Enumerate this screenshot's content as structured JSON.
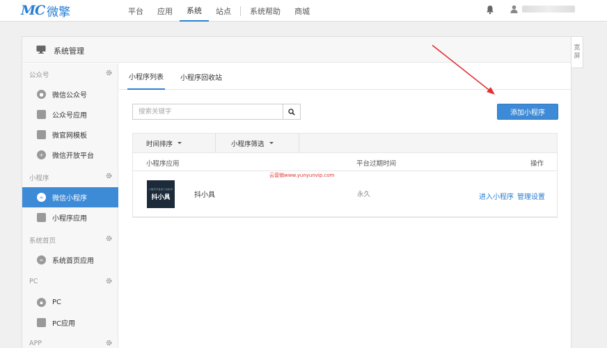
{
  "brand": {
    "mark": "MC",
    "name": "微擎"
  },
  "topnav": {
    "items": [
      {
        "label": "平台"
      },
      {
        "label": "应用"
      },
      {
        "label": "系统"
      },
      {
        "label": "站点"
      },
      {
        "label": "系统帮助"
      },
      {
        "label": "商城"
      }
    ],
    "active_index": 2,
    "notification_icon": "bell-icon",
    "user_icon": "user-icon"
  },
  "panel": {
    "title": "系统管理",
    "icon": "monitor-icon"
  },
  "side_toggle": {
    "line1": "宽",
    "line2": "屏"
  },
  "sidebar": {
    "groups": [
      {
        "label": "公众号",
        "items": [
          {
            "label": "微信公众号",
            "icon": "wechat-icon"
          },
          {
            "label": "公众号应用",
            "icon": "app-icon"
          },
          {
            "label": "微官网模板",
            "icon": "template-icon"
          },
          {
            "label": "微信开放平台",
            "icon": "open-platform-icon"
          }
        ]
      },
      {
        "label": "小程序",
        "items": [
          {
            "label": "微信小程序",
            "icon": "miniprogram-icon"
          },
          {
            "label": "小程序应用",
            "icon": "app-icon"
          }
        ]
      },
      {
        "label": "系统首页",
        "items": [
          {
            "label": "系统首页应用",
            "icon": "home-app-icon"
          }
        ]
      },
      {
        "label": "PC",
        "items": [
          {
            "label": "PC",
            "icon": "pc-icon"
          },
          {
            "label": "PC应用",
            "icon": "app-icon"
          }
        ]
      },
      {
        "label": "APP",
        "items": []
      }
    ],
    "active_item": "微信小程序"
  },
  "tabs": [
    {
      "label": "小程序列表"
    },
    {
      "label": "小程序回收站"
    }
  ],
  "search": {
    "placeholder": "搜索关键字",
    "value": ""
  },
  "add_button": "添加小程序",
  "filters": [
    {
      "label": "时间排序"
    },
    {
      "label": "小程序筛选"
    }
  ],
  "table": {
    "columns": [
      "小程序应用",
      "平台过期时间",
      "操作"
    ],
    "rows": [
      {
        "thumb_text": "抖小具",
        "thumb_subtext": "小程序开发者工具助手",
        "name": "抖小具",
        "expire": "永久",
        "actions": [
          "进入小程序",
          "管理设置"
        ]
      }
    ]
  },
  "watermark": "云营销www.yunyunvip.com",
  "colors": {
    "accent": "#2a7fd4",
    "sidebar_active": "#3d8ad6",
    "annotation_arrow": "#e03030"
  }
}
